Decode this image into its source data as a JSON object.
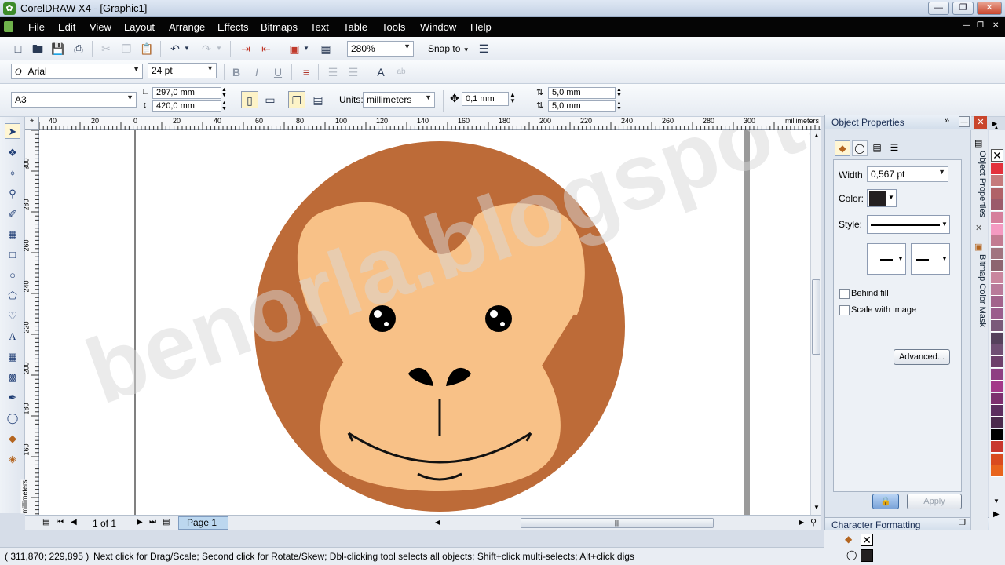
{
  "app": {
    "title": "CorelDRAW X4 - [Graphic1]"
  },
  "menu": [
    "File",
    "Edit",
    "View",
    "Layout",
    "Arrange",
    "Effects",
    "Bitmaps",
    "Text",
    "Table",
    "Tools",
    "Window",
    "Help"
  ],
  "standard_toolbar": {
    "zoom": "280%",
    "snap_to": "Snap to"
  },
  "text_toolbar": {
    "font_name": "Arial",
    "font_size": "24 pt"
  },
  "property_bar": {
    "paper": "A3",
    "width": "297,0 mm",
    "height": "420,0 mm",
    "units_label": "Units:",
    "units": "millimeters",
    "nudge": "0,1 mm",
    "dup_x": "5,0 mm",
    "dup_y": "5,0 mm"
  },
  "ruler": {
    "h_ticks": [
      "40",
      "20",
      "0",
      "20",
      "40",
      "60",
      "80",
      "100",
      "120",
      "140",
      "160",
      "180",
      "200",
      "220",
      "240",
      "260",
      "280",
      "300"
    ],
    "h_unit": "millimeters",
    "v_ticks": [
      "300",
      "280",
      "260",
      "240",
      "220",
      "200",
      "180",
      "160"
    ],
    "v_unit": "millimeters"
  },
  "drawing": {
    "watermark": "benorla.blogspot.com",
    "colors": {
      "head": "#bd6b38",
      "face": "#f8c187",
      "eye": "#000000",
      "line": "#111111"
    }
  },
  "page_nav": {
    "counter": "1 of 1",
    "page_tab": "Page 1"
  },
  "status": {
    "coords": "( 311,870; 229,895 )",
    "hint": "Next click for Drag/Scale; Second click for Rotate/Skew; Dbl-clicking tool selects all objects; Shift+click multi-selects; Alt+click digs"
  },
  "object_properties": {
    "title": "Object Properties",
    "width_label": "Width",
    "width_value": "0,567 pt",
    "color_label": "Color:",
    "style_label": "Style:",
    "behind_fill": "Behind fill",
    "scale_with_image": "Scale with image",
    "advanced": "Advanced...",
    "apply": "Apply",
    "outline_color": "#231f20"
  },
  "char_formatting": {
    "title": "Character Formatting"
  },
  "docker_tabs": [
    "Object Properties",
    "Bitmap Color Mask"
  ],
  "palette": [
    "#e3313c",
    "#c57a7c",
    "#b06268",
    "#9b5b6b",
    "#d57f9c",
    "#f49ac1",
    "#c27b91",
    "#a1747f",
    "#8d6570",
    "#c9869e",
    "#b97a9a",
    "#a2638c",
    "#9a5d8d",
    "#7a5a7a",
    "#55415c",
    "#704f74",
    "#6d3f6b",
    "#8e3f83",
    "#a33889",
    "#7d2f6f",
    "#5c2d5f",
    "#4b2a4d",
    "#000000",
    "#c8372e",
    "#d94b1f",
    "#e8641d"
  ]
}
